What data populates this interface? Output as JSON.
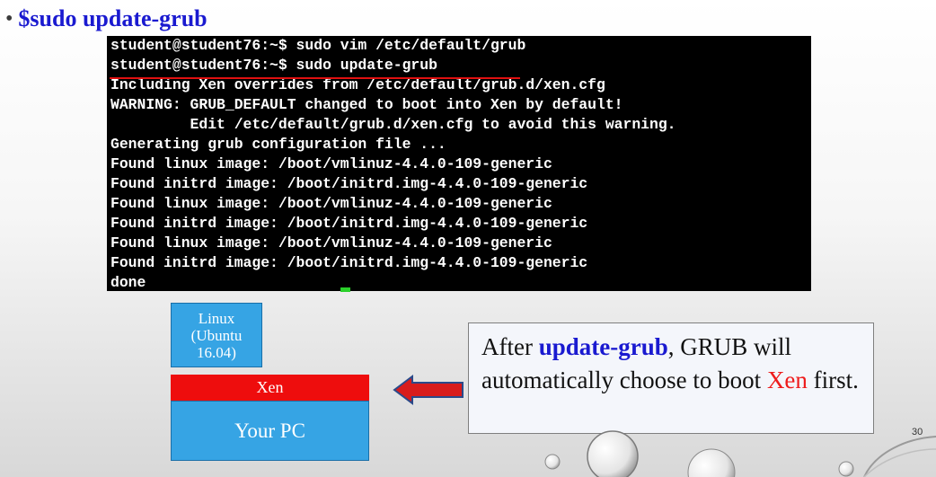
{
  "slide": {
    "bullet": "•",
    "heading": "$sudo update-grub",
    "page_number": "30"
  },
  "terminal": {
    "lines": [
      "student@student76:~$ sudo vim /etc/default/grub",
      "student@student76:~$ sudo update-grub",
      "Including Xen overrides from /etc/default/grub.d/xen.cfg",
      "WARNING: GRUB_DEFAULT changed to boot into Xen by default!",
      "         Edit /etc/default/grub.d/xen.cfg to avoid this warning.",
      "Generating grub configuration file ...",
      "Found linux image: /boot/vmlinuz-4.4.0-109-generic",
      "Found initrd image: /boot/initrd.img-4.4.0-109-generic",
      "Found linux image: /boot/vmlinuz-4.4.0-109-generic",
      "Found initrd image: /boot/initrd.img-4.4.0-109-generic",
      "Found linux image: /boot/vmlinuz-4.4.0-109-generic",
      "Found initrd image: /boot/initrd.img-4.4.0-109-generic",
      "done"
    ]
  },
  "diagram": {
    "linux_line1": "Linux",
    "linux_line2": "(Ubuntu",
    "linux_line3": "16.04)",
    "xen_label": "Xen",
    "pc_label": "Your PC",
    "colors": {
      "blue_box": "#36a4e4",
      "red_box": "#ee0d0d"
    }
  },
  "callout": {
    "text_before": "After ",
    "highlight": "update-grub",
    "text_middle": ", GRUB will automatically choose to boot ",
    "red_word": "Xen",
    "text_after": " first."
  }
}
